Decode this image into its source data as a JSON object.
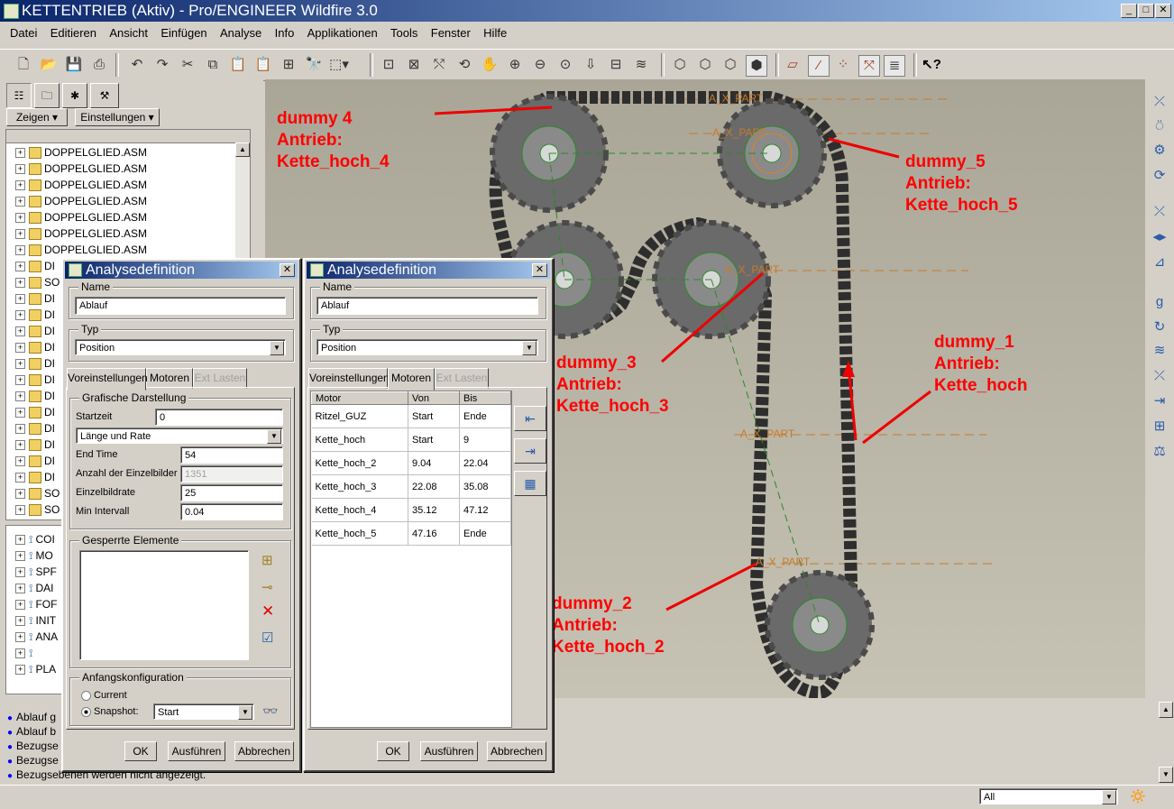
{
  "window": {
    "title": "KETTENTRIEB (Aktiv) - Pro/ENGINEER Wildfire 3.0",
    "min": "_",
    "max": "□",
    "close": "✕"
  },
  "menu": [
    "Datei",
    "Editieren",
    "Ansicht",
    "Einfügen",
    "Analyse",
    "Info",
    "Applikationen",
    "Tools",
    "Fenster",
    "Hilfe"
  ],
  "toolbar_icons": [
    "new-icon",
    "open-icon",
    "save-icon",
    "print-icon",
    "undo-icon",
    "redo-icon",
    "cut-icon",
    "copy-icon",
    "paste-icon",
    "paste-special-icon",
    "regenerate-icon",
    "find-icon",
    "select-box-icon",
    "repaint-icon",
    "orient-icon",
    "spin-center-icon",
    "saved-views-icon",
    "pan-icon",
    "zoom-in-icon",
    "zoom-out-icon",
    "refit-icon",
    "reorient-icon",
    "named-view-icon",
    "layers-icon",
    "wireframe-icon",
    "hidden-line-icon",
    "no-hidden-icon",
    "shading-icon",
    "datum-planes-icon",
    "datum-axes-icon",
    "datum-points-icon",
    "coord-sys-icon",
    "annotations-icon",
    "whats-this-icon"
  ],
  "left_panel": {
    "zeigen": "Zeigen",
    "einstellungen": "Einstellungen",
    "tree_items": [
      "DOPPELGLIED.ASM",
      "DOPPELGLIED.ASM",
      "DOPPELGLIED.ASM",
      "DOPPELGLIED.ASM",
      "DOPPELGLIED.ASM",
      "DOPPELGLIED.ASM",
      "DOPPELGLIED.ASM"
    ],
    "tree_partial": [
      "DI",
      "SO",
      "DI",
      "DI",
      "DI",
      "DI",
      "DI",
      "DI",
      "DI",
      "DI",
      "DI",
      "DI",
      "DI",
      "DI",
      "SO",
      "SO"
    ],
    "mech_tree": [
      "COI",
      "MO",
      "SPF",
      "DAI",
      "FOF",
      "INIT",
      "ANA",
      "",
      "PLA"
    ]
  },
  "messages": [
    "Ablauf g",
    "Ablauf b",
    "Bezugse",
    "Bezugse",
    "Bezugsebenen werden nicht angezeigt."
  ],
  "status": {
    "filter": "All"
  },
  "annotations": [
    {
      "text": "dummy 4\nAntrieb:\nKette_hoch_4"
    },
    {
      "text": "dummy_5\nAntrieb:\nKette_hoch_5"
    },
    {
      "text": "dummy_3\nAntrieb:\nKette_hoch_3"
    },
    {
      "text": "dummy_1\nAntrieb:\nKette_hoch"
    },
    {
      "text": "dummy_2\nAntrieb:\nKette_hoch_2"
    }
  ],
  "axis_label": "A_X_PART",
  "dialog1": {
    "title": "Analysedefinition",
    "name_label": "Name",
    "name_value": "Ablauf",
    "typ_label": "Typ",
    "typ_value": "Position",
    "tabs": [
      "Voreinstellungen",
      "Motoren",
      "Ext Lasten"
    ],
    "grafische": "Grafische Darstellung",
    "startzeit_label": "Startzeit",
    "startzeit_value": "0",
    "mode_value": "Länge und Rate",
    "endtime_label": "End Time",
    "endtime_value": "54",
    "anzahl_label": "Anzahl der Einzelbilder",
    "anzahl_value": "1351",
    "rate_label": "Einzelbildrate",
    "rate_value": "25",
    "min_label": "Min Intervall",
    "min_value": "0.04",
    "gesperrte": "Gesperrte Elemente",
    "anfang": "Anfangskonfiguration",
    "current": "Current",
    "snapshot": "Snapshot:",
    "snapshot_value": "Start",
    "ok": "OK",
    "ausfuehren": "Ausführen",
    "abbrechen": "Abbrechen"
  },
  "dialog2": {
    "title": "Analysedefinition",
    "name_label": "Name",
    "name_value": "Ablauf",
    "typ_label": "Typ",
    "typ_value": "Position",
    "tabs": [
      "Voreinstellungen",
      "Motoren",
      "Ext Lasten"
    ],
    "columns": [
      "Motor",
      "Von",
      "Bis"
    ],
    "rows": [
      [
        "Ritzel_GUZ",
        "Start",
        "Ende"
      ],
      [
        "Kette_hoch",
        "Start",
        "9"
      ],
      [
        "Kette_hoch_2",
        "9.04",
        "22.04"
      ],
      [
        "Kette_hoch_3",
        "22.08",
        "35.08"
      ],
      [
        "Kette_hoch_4",
        "35.12",
        "47.12"
      ],
      [
        "Kette_hoch_5",
        "47.16",
        "Ende"
      ]
    ],
    "ok": "OK",
    "ausfuehren": "Ausführen",
    "abbrechen": "Abbrechen"
  }
}
